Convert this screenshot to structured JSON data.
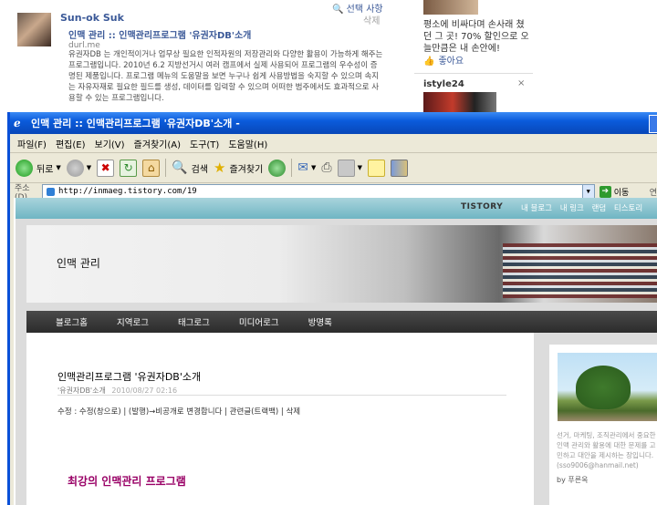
{
  "fb": {
    "name": "Sun-ok Suk",
    "select": "선택 사항",
    "delete": "삭제",
    "link_title": "인맥 관리 :: 인맥관리프로그램 '유권자DB'소개",
    "domain": "durl.me",
    "description": "유권자DB 는 개인적이거나 업무상 필요한 인적자원의 저장관리와 다양한 활용이 가능하게 해주는 프로그램입니다. 2010년 6.2 지방선거시 여러 캠프에서 실제 사용되어 프로그램의 우수성이 증명된 제품입니다. 프로그램 메뉴의 도움말을 보면 누구나 쉽게 사용방법을 숙지할 수 있으며 속지는 자유자재로 필요한 필드를 생성, 데이터를 입력할 수 있으며 어떠한 범주에서도 효과적으로 사용할 수 있는 프로그램입니다.",
    "ad_text": "평소에 비싸다며 손사래 쳤던 그 곳! 70% 할인으로 오늘만큼은 내 손안에!",
    "like": "좋아요",
    "istyle": "istyle24",
    "close": "×"
  },
  "window": {
    "title": "인맥 관리 :: 인맥관리프로그램 '유권자DB'소개 -"
  },
  "menu": [
    "파일(F)",
    "편집(E)",
    "보기(V)",
    "즐겨찾기(A)",
    "도구(T)",
    "도움말(H)"
  ],
  "toolbar": {
    "back": "뒤로",
    "search": "검색",
    "favorites": "즐겨찾기"
  },
  "address": {
    "label": "주소(D)",
    "url": "http://inmaeg.tistory.com/19",
    "go": "이동",
    "links": "연"
  },
  "blog": {
    "tistory": "TISTORY",
    "top_nav": [
      "내 블로그",
      "내 링크",
      "랜덤",
      "티스토리"
    ],
    "title": "인맥 관리",
    "menu": [
      "블로그홈",
      "지역로그",
      "태그로그",
      "미디어로그",
      "방명록"
    ],
    "post_title": "인맥관리프로그램 '유권자DB'소개",
    "post_category": "'유권자DB'소개",
    "post_date": "2010/08/27 02:16",
    "post_actions": "수정 : 수정(창으로) | (발행)→비공개로 변경합니다 | 관련글(트랙백) | 삭제",
    "post_heading": "최강의 인맥관리 프로그램",
    "side_text": "선거, 마케팅, 조직관리에서 중요한 인맥 관리와 활용에 대한 문제를 고민하고 대안을 제시하는 장입니다.(sso9006@hanmail.net)",
    "side_by_prefix": "by",
    "side_by": "푸른옥"
  },
  "colors": {
    "fb_blue": "#3b5998",
    "xp_title": "#0a5bdb",
    "heading": "#990066"
  }
}
